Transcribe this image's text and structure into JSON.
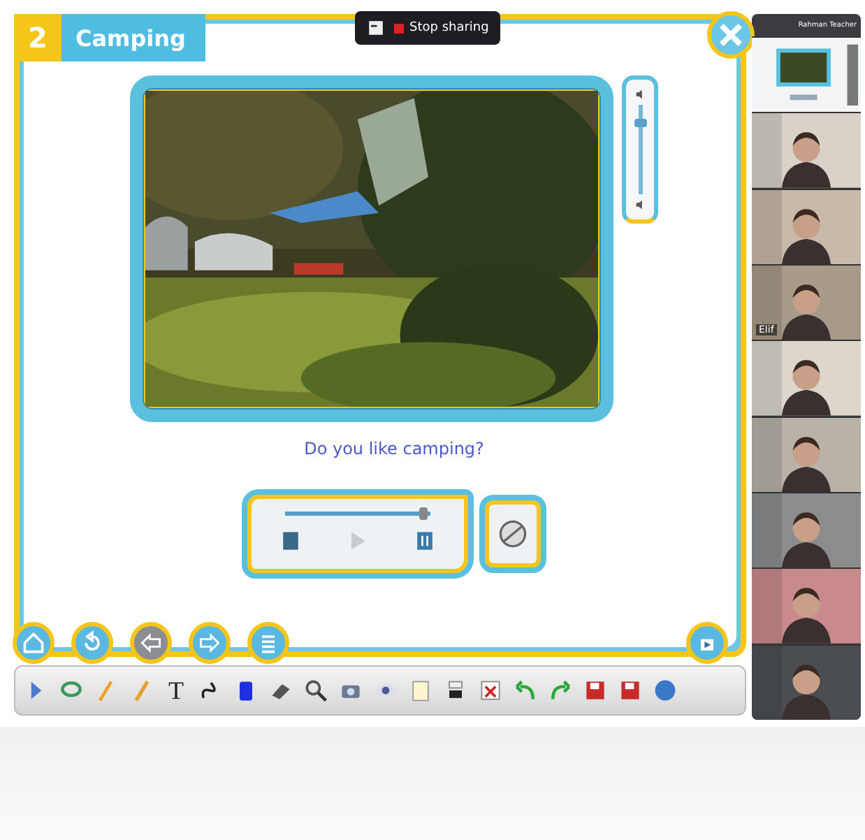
{
  "sharing_bar": {
    "label": "Stop sharing"
  },
  "lesson": {
    "number": "2",
    "title": "Camping"
  },
  "video": {
    "caption": "Do you like camping?",
    "volume": {
      "level": 0.85
    },
    "progress": {
      "level": 0.95
    }
  },
  "nav_buttons": [
    {
      "kind": "home",
      "disabled": false
    },
    {
      "kind": "replay",
      "disabled": false
    },
    {
      "kind": "back",
      "disabled": true
    },
    {
      "kind": "forward",
      "disabled": false
    },
    {
      "kind": "list",
      "disabled": false
    }
  ],
  "toolbar": [
    {
      "kind": "expand"
    },
    {
      "kind": "lasso"
    },
    {
      "kind": "pencil"
    },
    {
      "kind": "marker"
    },
    {
      "kind": "text",
      "label": "T"
    },
    {
      "kind": "curve"
    },
    {
      "kind": "color"
    },
    {
      "kind": "eraser"
    },
    {
      "kind": "zoom"
    },
    {
      "kind": "camera"
    },
    {
      "kind": "eye"
    },
    {
      "kind": "note"
    },
    {
      "kind": "screen"
    },
    {
      "kind": "delete"
    },
    {
      "kind": "undo"
    },
    {
      "kind": "redo"
    },
    {
      "kind": "save"
    },
    {
      "kind": "save"
    },
    {
      "kind": "globe"
    }
  ],
  "participants_panel": {
    "title": "Rahman Teacher",
    "tiles": [
      {
        "kind": "screen"
      },
      {
        "kind": "person"
      },
      {
        "kind": "person"
      },
      {
        "kind": "person",
        "name": "Elif"
      },
      {
        "kind": "person"
      },
      {
        "kind": "person"
      },
      {
        "kind": "person"
      },
      {
        "kind": "person"
      },
      {
        "kind": "person"
      }
    ]
  }
}
